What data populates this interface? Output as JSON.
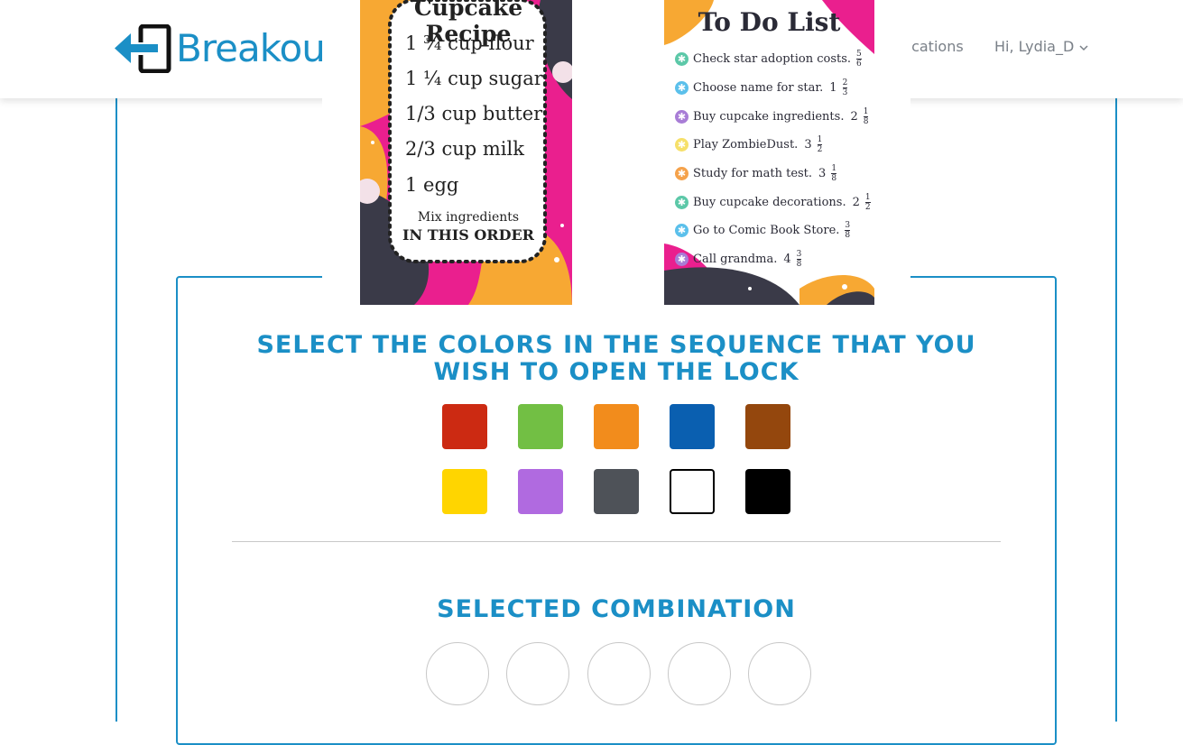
{
  "header": {
    "logo_text": "Breakou",
    "notifications_label": "fications",
    "user_greeting": "Hi, Lydia_D",
    "accent": "#1b8fc6"
  },
  "recipe": {
    "title": "Cupcake Recipe",
    "items": [
      "1 ¾ cup flour",
      "1 ¼ cup sugar",
      "1/3 cup butter",
      "2/3 cup milk",
      "1 egg"
    ],
    "note_line1": "Mix ingredients",
    "note_line2": "IN THIS ORDER"
  },
  "todo": {
    "title": "To Do List",
    "items": [
      {
        "text": "Check star adoption costs.",
        "whole": "",
        "num": "5",
        "den": "6",
        "bullet": "#5cc8a8"
      },
      {
        "text": "Choose name for star.",
        "whole": "1",
        "num": "2",
        "den": "3",
        "bullet": "#5bc0eb"
      },
      {
        "text": "Buy cupcake ingredients.",
        "whole": "2",
        "num": "1",
        "den": "8",
        "bullet": "#a87dd6"
      },
      {
        "text": "Play ZombieDust.",
        "whole": "3",
        "num": "1",
        "den": "2",
        "bullet": "#f6e06a"
      },
      {
        "text": "Study for math test.",
        "whole": "3",
        "num": "1",
        "den": "8",
        "bullet": "#f5a24b"
      },
      {
        "text": "Buy cupcake decorations.",
        "whole": "2",
        "num": "1",
        "den": "2",
        "bullet": "#5cc8a8"
      },
      {
        "text": "Go to Comic Book Store.",
        "whole": "",
        "num": "3",
        "den": "8",
        "bullet": "#5bc0eb"
      },
      {
        "text": "Call grandma.",
        "whole": "4",
        "num": "3",
        "den": "8",
        "bullet": "#a87dd6"
      }
    ]
  },
  "lock": {
    "instruction": "SELECT THE COLORS IN THE SEQUENCE THAT YOU WISH TO OPEN THE LOCK",
    "selected_title": "SELECTED COMBINATION",
    "colors": [
      {
        "name": "red",
        "hex": "#cc2a12"
      },
      {
        "name": "green",
        "hex": "#72bf44"
      },
      {
        "name": "orange",
        "hex": "#f28c1c"
      },
      {
        "name": "blue",
        "hex": "#0a5fb0"
      },
      {
        "name": "brown",
        "hex": "#94470d"
      },
      {
        "name": "yellow",
        "hex": "#ffd500"
      },
      {
        "name": "purple",
        "hex": "#b06ae0"
      },
      {
        "name": "gray",
        "hex": "#4e5258"
      },
      {
        "name": "white",
        "hex": "#ffffff"
      },
      {
        "name": "black",
        "hex": "#000000"
      }
    ],
    "slots": 5
  }
}
